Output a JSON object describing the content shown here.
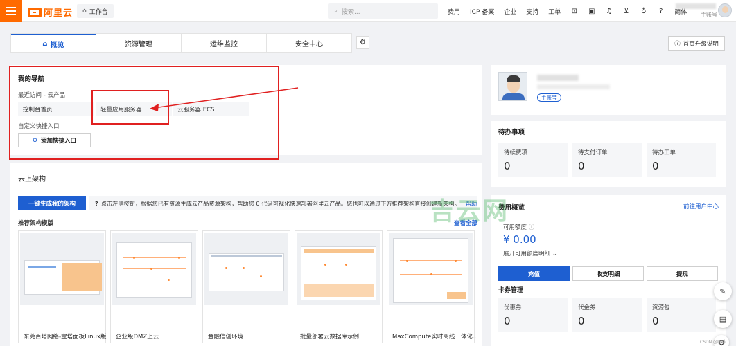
{
  "topbar": {
    "logo_text": "阿里云",
    "workbench_label": "工作台",
    "search_placeholder": "搜索...",
    "links": [
      "费用",
      "ICP 备案",
      "企业",
      "支持",
      "工单"
    ],
    "lang": "简体",
    "account_type": "主账号"
  },
  "tabs": [
    {
      "label": "概览",
      "active": true
    },
    {
      "label": "资源管理",
      "active": false
    },
    {
      "label": "运维监控",
      "active": false
    },
    {
      "label": "安全中心",
      "active": false
    }
  ],
  "upgrade_label": "首页升级说明",
  "my_nav": {
    "title": "我的导航",
    "recent_label": "最近访问 - 云产品",
    "recent_items": [
      "控制台首页",
      "轻量应用服务器",
      "云服务器 ECS"
    ],
    "custom_label": "自定义快捷入口",
    "add_label": "添加快捷入口"
  },
  "architecture": {
    "title": "云上架构",
    "generate_label": "一键生成我的架构",
    "tip": "点击左侧按钮，根据您已有资源生成云产品资源架构，帮助您 0 代码可视化快速部署阿里云产品。您也可以通过下方推荐架构直接创建新架构。",
    "help_link": "帮助文档",
    "recommend_label": "推荐架构模版",
    "see_all": "查看全部",
    "templates": [
      {
        "name": "东莞百塔网络-宝塔面板Linux版"
      },
      {
        "name": "企业级DMZ上云"
      },
      {
        "name": "金融信创环境"
      },
      {
        "name": "批量部署云数据库示例"
      },
      {
        "name": "MaxCompute实时离线一体化..."
      }
    ]
  },
  "profile": {
    "badge": "主账号"
  },
  "todo": {
    "title": "待办事项",
    "items": [
      {
        "label": "待续费项",
        "value": "0"
      },
      {
        "label": "待支付订单",
        "value": "0"
      },
      {
        "label": "待办工单",
        "value": "0"
      }
    ]
  },
  "fees": {
    "title": "费用概览",
    "link": "前往用户中心",
    "available_label": "可用额度",
    "amount": "¥ 0.00",
    "expand_label": "展开可用额度明细",
    "buttons": [
      "充值",
      "收支明细",
      "提现"
    ],
    "coupon_title": "卡券管理",
    "coupons": [
      {
        "label": "优惠券",
        "value": "0"
      },
      {
        "label": "代金券",
        "value": "0"
      },
      {
        "label": "资源包",
        "value": "0"
      }
    ]
  },
  "watermark": "吉云网",
  "footer_mark": "CSDN @咖啡..."
}
